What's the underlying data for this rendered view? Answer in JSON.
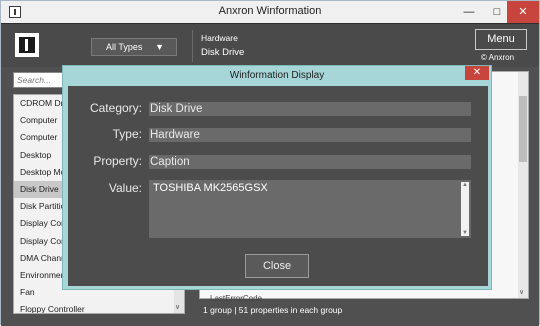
{
  "window": {
    "title": "Anxron Winformation",
    "minimize": "—",
    "maximize": "□",
    "close": "✕"
  },
  "header": {
    "types_button": "All Types",
    "types_caret": "▼",
    "category_label": "Hardware",
    "category_value": "Disk Drive",
    "menu_button": "Menu",
    "copyright": "© Anxron"
  },
  "sidebar": {
    "search_placeholder": "Search...",
    "items": [
      {
        "label": "CDROM Drive",
        "selected": false
      },
      {
        "label": "Computer",
        "selected": false
      },
      {
        "label": "Computer",
        "selected": false
      },
      {
        "label": "Desktop",
        "selected": false
      },
      {
        "label": "Desktop Monitor",
        "selected": false
      },
      {
        "label": "Disk Drive",
        "selected": true
      },
      {
        "label": "Disk Partition",
        "selected": false
      },
      {
        "label": "Display Controller",
        "selected": false
      },
      {
        "label": "Display Controller",
        "selected": false
      },
      {
        "label": "DMA Channel",
        "selected": false
      },
      {
        "label": "Environment",
        "selected": false
      },
      {
        "label": "Fan",
        "selected": false
      },
      {
        "label": "Floppy Controller",
        "selected": false
      }
    ],
    "scroll_down": "∨"
  },
  "main": {
    "peek_text": "LastErrorCode",
    "status": "1 group | 51 properties in each group",
    "scroll_down": "∨"
  },
  "modal": {
    "title": "Winformation Display",
    "close": "✕",
    "fields": {
      "category_label": "Category:",
      "category_value": "Disk Drive",
      "type_label": "Type:",
      "type_value": "Hardware",
      "property_label": "Property:",
      "property_value": "Caption",
      "value_label": "Value:",
      "value_value": "TOSHIBA MK2565GSX"
    },
    "close_button": "Close"
  },
  "colors": {
    "header_bg": "#4a4a4a",
    "modal_frame": "#a6d6d8",
    "close_red": "#c7453c"
  }
}
